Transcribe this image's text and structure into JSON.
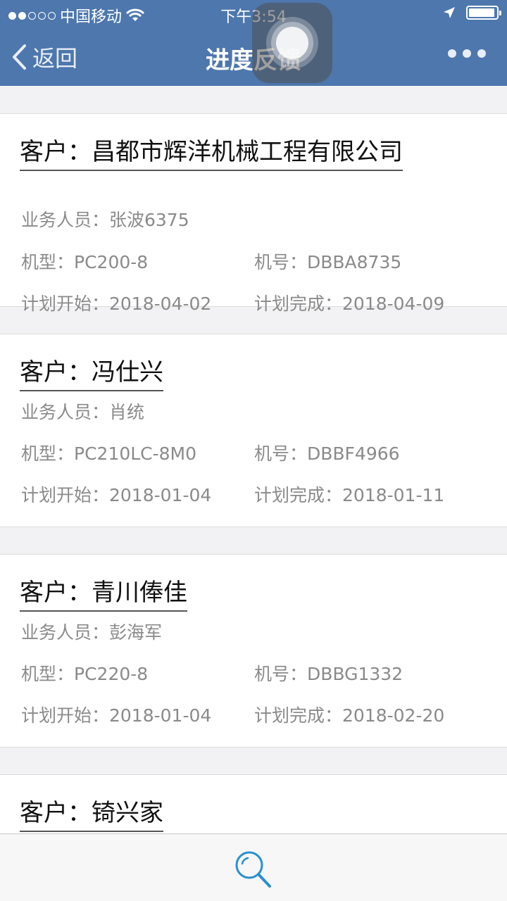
{
  "status_bar": {
    "carrier": "中国移动",
    "time": "下午3:54"
  },
  "nav": {
    "back_label": "返回",
    "title": "进度反馈"
  },
  "cards": [
    {
      "customer": "客户：昌都市辉洋机械工程有限公司",
      "salesperson": "业务人员：张波6375",
      "model": "机型：PC200-8",
      "serial": "机号：DBBA8735",
      "plan_start": "计划开始：2018-04-02",
      "plan_end": "计划完成：2018-04-09"
    },
    {
      "customer": "客户：冯仕兴",
      "salesperson": "业务人员：肖统",
      "model": "机型：PC210LC-8M0",
      "serial": "机号：DBBF4966",
      "plan_start": "计划开始：2018-01-04",
      "plan_end": "计划完成：2018-01-11"
    },
    {
      "customer": "客户：青川俸佳",
      "salesperson": "业务人员：彭海军",
      "model": "机型：PC220-8",
      "serial": "机号：DBBG1332",
      "plan_start": "计划开始：2018-01-04",
      "plan_end": "计划完成：2018-02-20"
    },
    {
      "customer": "客户：锜兴家"
    }
  ],
  "bottom_bar": {
    "icon": "search-icon"
  },
  "colors": {
    "header": "#4d77ad",
    "accent": "#2a8fd0",
    "muted_text": "#8a8a8a"
  }
}
